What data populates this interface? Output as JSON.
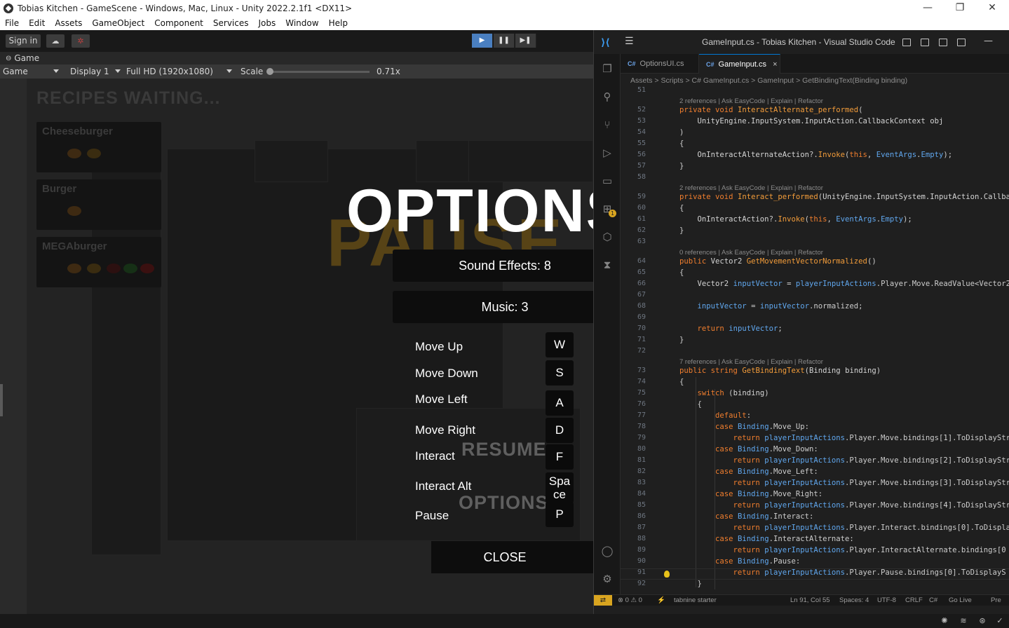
{
  "unity": {
    "window_title": "Tobias Kitchen - GameScene - Windows, Mac, Linux - Unity 2022.2.1f1 <DX11>",
    "window_controls": {
      "minimize": "—",
      "maximize": "❐",
      "close": "✕"
    },
    "menu": [
      "File",
      "Edit",
      "Assets",
      "GameObject",
      "Component",
      "Services",
      "Jobs",
      "Window",
      "Help"
    ],
    "toolbar": {
      "sign_in": "Sign in",
      "cloud_icon": "cloud-icon",
      "collab_icon": "collab-icon"
    },
    "play_controls": [
      "play-icon",
      "pause-icon",
      "step-icon"
    ],
    "game_tab": "Game",
    "game_bar": {
      "view_mode": "Game",
      "display": "Display 1",
      "resolution": "Full HD (1920x1080)",
      "scale_label": "Scale",
      "scale_value": "0.71x",
      "scale_level": 0.0
    }
  },
  "game": {
    "recipes_title": "RECIPES WAITING...",
    "recipes": [
      {
        "name": "Cheeseburger"
      },
      {
        "name": "Burger"
      },
      {
        "name": "MEGAburger"
      }
    ],
    "pause_text": "PAUSE",
    "options_title": "OPTIONS",
    "sound_effects": "Sound Effects: 8",
    "music": "Music: 3",
    "bindings": [
      {
        "label": "Move Up",
        "key": "W"
      },
      {
        "label": "Move Down",
        "key": "S"
      },
      {
        "label": "Move Left",
        "key": "A"
      },
      {
        "label": "Move Right",
        "key": "D"
      },
      {
        "label": "Interact",
        "key": "F"
      },
      {
        "label": "Interact Alt",
        "key_line1": "Spa",
        "key_line2": "ce"
      },
      {
        "label": "Pause",
        "key": "P"
      }
    ],
    "ghost_resume": "RESUME",
    "ghost_options": "OPTIONS",
    "close": "CLOSE"
  },
  "vscode": {
    "title": "GameInput.cs - Tobias Kitchen - Visual Studio Code",
    "tabs": [
      {
        "name": "OptionsUI.cs",
        "lang": "C#"
      },
      {
        "name": "GameInput.cs",
        "lang": "C#",
        "close": "×"
      }
    ],
    "breadcrumb": "Assets > Scripts > C# GameInput.cs > GameInput > GetBindingText(Binding binding)",
    "code_lens": {
      "two_refs": "2 references | Ask EasyCode | Explain | Refactor",
      "zero_refs": "0 references | Ask EasyCode | Explain | Refactor",
      "seven_refs": "7 references | Ask EasyCode | Explain | Refactor"
    },
    "status": {
      "errors": "⊗ 0 ⚠ 0",
      "ports": "⚡",
      "tabnine": "tabnine starter",
      "position": "Ln 91, Col 55",
      "spaces": "Spaces: 4",
      "encoding": "UTF-8",
      "eol": "CRLF",
      "language": "C#",
      "golive": "Go Live",
      "prettier": "Pre"
    },
    "activity_icons": [
      "explorer-icon",
      "search-icon",
      "source-control-icon",
      "run-debug-icon",
      "remote-explorer-icon",
      "extensions-icon",
      "codeium-icon",
      "testing-icon",
      "account-icon",
      "settings-gear-icon"
    ],
    "extensions_badge": "1"
  },
  "code_lines": [
    {
      "n": "51",
      "t": ""
    },
    {
      "n": "",
      "lens": "2 references | Ask EasyCode | Explain | Refactor"
    },
    {
      "n": "52",
      "h": "<span class='k'>private</span> <span class='k'>void</span> <span class='fn'>InteractAlternate_performed</span>("
    },
    {
      "n": "53",
      "h": "    <span class='ty'>UnityEngine.InputSystem.InputAction.CallbackContext</span> <span class='pl'>obj</span>"
    },
    {
      "n": "54",
      "h": ")"
    },
    {
      "n": "55",
      "h": "{"
    },
    {
      "n": "56",
      "h": "    <span class='pl'>OnInteractAlternateAction</span>?.<span class='fn'>Invoke</span>(<span class='k'>this</span>, <span class='id'>EventArgs</span>.<span class='id'>Empty</span>);"
    },
    {
      "n": "57",
      "h": "}"
    },
    {
      "n": "58",
      "h": ""
    },
    {
      "n": "",
      "lens": "2 references | Ask EasyCode | Explain | Refactor"
    },
    {
      "n": "59",
      "h": "<span class='k'>private</span> <span class='k'>void</span> <span class='fn'>Interact_performed</span>(<span class='ty'>UnityEngine.InputSystem.InputAction.Callba</span>"
    },
    {
      "n": "60",
      "h": "{"
    },
    {
      "n": "61",
      "h": "    <span class='pl'>OnInteractAction</span>?.<span class='fn'>Invoke</span>(<span class='k'>this</span>, <span class='id'>EventArgs</span>.<span class='id'>Empty</span>);"
    },
    {
      "n": "62",
      "h": "}"
    },
    {
      "n": "63",
      "h": ""
    },
    {
      "n": "",
      "lens": "0 references | Ask EasyCode | Explain | Refactor"
    },
    {
      "n": "64",
      "h": "<span class='k'>public</span> <span class='ty'>Vector2</span> <span class='fn'>GetMovementVectorNormalized</span>()"
    },
    {
      "n": "65",
      "h": "{"
    },
    {
      "n": "66",
      "h": "    <span class='ty'>Vector2</span> <span class='id'>inputVector</span> = <span class='id'>playerInputActions</span>.Player.Move.ReadValue&lt;Vector2"
    },
    {
      "n": "67",
      "h": ""
    },
    {
      "n": "68",
      "h": "    <span class='id'>inputVector</span> = <span class='id'>inputVector</span>.normalized;"
    },
    {
      "n": "69",
      "h": ""
    },
    {
      "n": "70",
      "h": "    <span class='k'>return</span> <span class='id'>inputVector</span>;"
    },
    {
      "n": "71",
      "h": "}"
    },
    {
      "n": "72",
      "h": ""
    },
    {
      "n": "",
      "lens": "7 references | Ask EasyCode | Explain | Refactor"
    },
    {
      "n": "73",
      "h": "<span class='k'>public</span> <span class='k'>string</span> <span class='fn'>GetBindingText</span>(<span class='ty'>Binding</span> <span class='pl'>binding</span>)"
    },
    {
      "n": "74",
      "h": "{"
    },
    {
      "n": "75",
      "h": "    <span class='k'>switch</span> (<span class='pl'>binding</span>)"
    },
    {
      "n": "76",
      "h": "    {"
    },
    {
      "n": "77",
      "h": "        <span class='k'>default</span>:"
    },
    {
      "n": "78",
      "h": "        <span class='k'>case</span> <span class='id'>Binding</span>.Move_Up:"
    },
    {
      "n": "79",
      "h": "            <span class='k'>return</span> <span class='id'>playerInputActions</span>.Player.Move.bindings[<span class='pl'>1</span>].ToDisplayStr"
    },
    {
      "n": "80",
      "h": "        <span class='k'>case</span> <span class='id'>Binding</span>.Move_Down:"
    },
    {
      "n": "81",
      "h": "            <span class='k'>return</span> <span class='id'>playerInputActions</span>.Player.Move.bindings[<span class='pl'>2</span>].ToDisplayStr"
    },
    {
      "n": "82",
      "h": "        <span class='k'>case</span> <span class='id'>Binding</span>.Move_Left:"
    },
    {
      "n": "83",
      "h": "            <span class='k'>return</span> <span class='id'>playerInputActions</span>.Player.Move.bindings[<span class='pl'>3</span>].ToDisplayStr"
    },
    {
      "n": "84",
      "h": "        <span class='k'>case</span> <span class='id'>Binding</span>.Move_Right:"
    },
    {
      "n": "85",
      "h": "            <span class='k'>return</span> <span class='id'>playerInputActions</span>.Player.Move.bindings[<span class='pl'>4</span>].ToDisplayStr"
    },
    {
      "n": "86",
      "h": "        <span class='k'>case</span> <span class='id'>Binding</span>.Interact:"
    },
    {
      "n": "87",
      "h": "            <span class='k'>return</span> <span class='id'>playerInputActions</span>.Player.Interact.bindings[<span class='pl'>0</span>].ToDispla"
    },
    {
      "n": "88",
      "h": "        <span class='k'>case</span> <span class='id'>Binding</span>.InteractAlternate:"
    },
    {
      "n": "89",
      "h": "            <span class='k'>return</span> <span class='id'>playerInputActions</span>.Player.InteractAlternate.bindings[<span class='pl'>0</span>"
    },
    {
      "n": "90",
      "h": "        <span class='k'>case</span> <span class='id'>Binding</span>.Pause:"
    },
    {
      "n": "91",
      "h": "            <span class='k'>return</span> <span class='id'>playerInputActions</span>.Player.Pause.bindings[<span class='pl'>0</span>].ToDisplayS"
    },
    {
      "n": "92",
      "h": "    }"
    }
  ]
}
